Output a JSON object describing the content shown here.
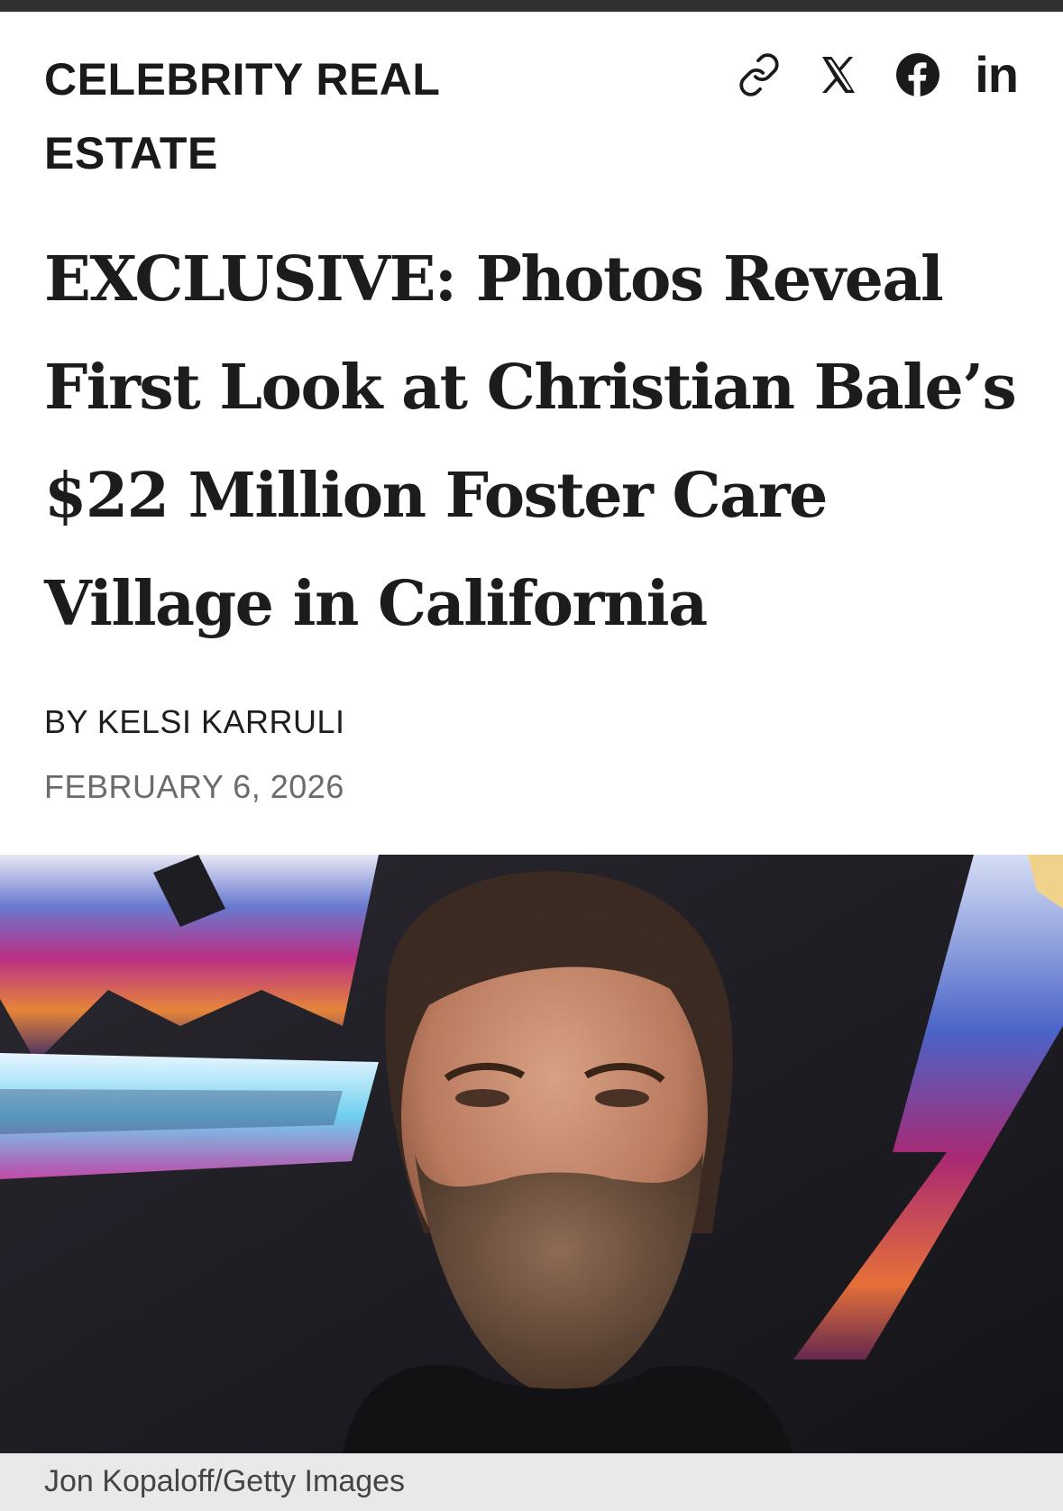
{
  "article": {
    "category": "CELEBRITY REAL ESTATE",
    "headline": "EXCLUSIVE: Photos Reveal First Look at Christian Bale’s $22 Million Foster Care Village in California",
    "byline_prefix": "BY",
    "author": "KELSI KARRULI",
    "date": "FEBRUARY 6, 2026",
    "photo_credit": "Jon Kopaloff/Getty Images"
  },
  "share": {
    "icons": [
      "link-icon",
      "x-icon",
      "facebook-icon",
      "linkedin-icon"
    ],
    "linkedin_label": "in"
  },
  "colors": {
    "text": "#1c1c1c",
    "date": "#6b6b6b",
    "top_bar": "#2f3133",
    "caption_bg": "#e9e9e9"
  }
}
